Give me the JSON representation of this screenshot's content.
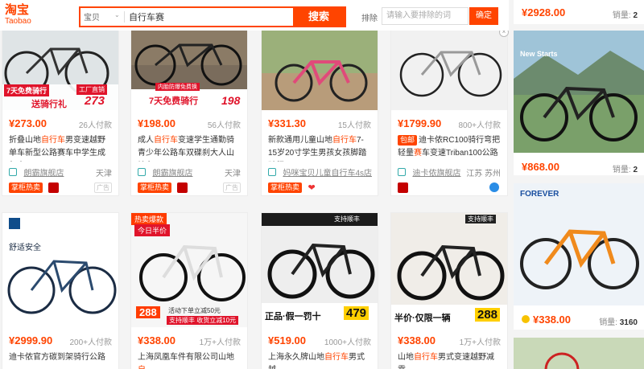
{
  "header": {
    "logo_cn": "淘宝",
    "logo_en": "Taobao",
    "search_scope": "宝贝",
    "search_query": "自行车赛",
    "search_button": "搜索",
    "exclude_label": "排除",
    "exclude_placeholder": "请输入要排除的词",
    "exclude_button": "确定"
  },
  "colors": {
    "accent": "#ff4400",
    "tmall_red": "#c40000"
  },
  "products": [
    {
      "price": "¥273.00",
      "sales": "26人付款",
      "title_pre": "折叠山地",
      "title_em": "自行车",
      "title_post": "男变速越野单车新型公路赛车中学生成年大",
      "shop": "朗霸旗舰店",
      "location": "天津",
      "badge": "掌柜热卖",
      "overlay": [
        "7天免费骑行",
        "送骑行礼",
        "工厂直销",
        "273"
      ]
    },
    {
      "price": "¥198.00",
      "sales": "56人付款",
      "title_pre": "成人",
      "title_em": "自行车",
      "title_post": "变速学生通勤骑青少年公路车双碟刹大人山地车",
      "shop": "朗霸旗舰店",
      "location": "天津",
      "badge": "掌柜热卖",
      "overlay": [
        "内胎防爆免费换",
        "7天免费骑行",
        "198"
      ]
    },
    {
      "price": "¥331.30",
      "sales": "15人付款",
      "title_pre": "新款通用儿童山地",
      "title_em": "自行车",
      "title_post": "7-15岁20寸学生男孩女孩脚踏骑行",
      "shop": "妈咪宝贝儿童自行车4s店",
      "location": "",
      "badge": "掌柜热卖",
      "overlay": []
    },
    {
      "price": "¥1799.90",
      "sales": "800+人付款",
      "title_pre": "迪卡侬RC100骑行弯把轻量",
      "title_em": "赛",
      "title_post": "车变速Triban100公路",
      "tag": "包邮",
      "shop": "迪卡侬旗舰店",
      "location": "江苏 苏州",
      "badge": "",
      "overlay": []
    },
    {
      "price": "¥2999.90",
      "sales": "200+人付款",
      "title_pre": "迪卡侬官方碳到架骑行公路",
      "title_em": "",
      "title_post": "",
      "shop": "",
      "location": "",
      "badge": "",
      "overlay": [
        "舒适安全"
      ]
    },
    {
      "price": "¥338.00",
      "sales": "1万+人付款",
      "title_pre": "上海凤凰车件有限公司山地",
      "title_em": "自",
      "title_post": "",
      "shop": "",
      "location": "",
      "badge": "",
      "overlay": [
        "热卖爆款",
        "今日半价",
        "288",
        "活动下单立减50元",
        "支持顺丰 收货立减10元"
      ]
    },
    {
      "price": "¥519.00",
      "sales": "1000+人付款",
      "title_pre": "上海永久牌山地",
      "title_em": "自行车",
      "title_post": "男式越",
      "shop": "",
      "location": "",
      "badge": "",
      "overlay": [
        "支持顺丰",
        "正品·假一罚十",
        "479"
      ]
    },
    {
      "price": "¥338.00",
      "sales": "1万+人付款",
      "title_pre": "山地",
      "title_em": "自行车",
      "title_post": "男式变速越野减震",
      "shop": "",
      "location": "",
      "badge": "",
      "overlay": [
        "支持顺丰",
        "半价·仅限一辆",
        "288"
      ]
    }
  ],
  "sidebar": {
    "items": [
      {
        "price": "¥2928.00",
        "sales_label": "销量:",
        "sales": "2"
      },
      {
        "price": "¥868.00",
        "sales_label": "销量:",
        "sales": "2",
        "overlay": "New Starts"
      },
      {
        "price": "¥338.00",
        "sales_label": "销量:",
        "sales": "3160",
        "overlay": "FOREVER"
      }
    ]
  },
  "ad_label": "广告",
  "close_label": "×"
}
